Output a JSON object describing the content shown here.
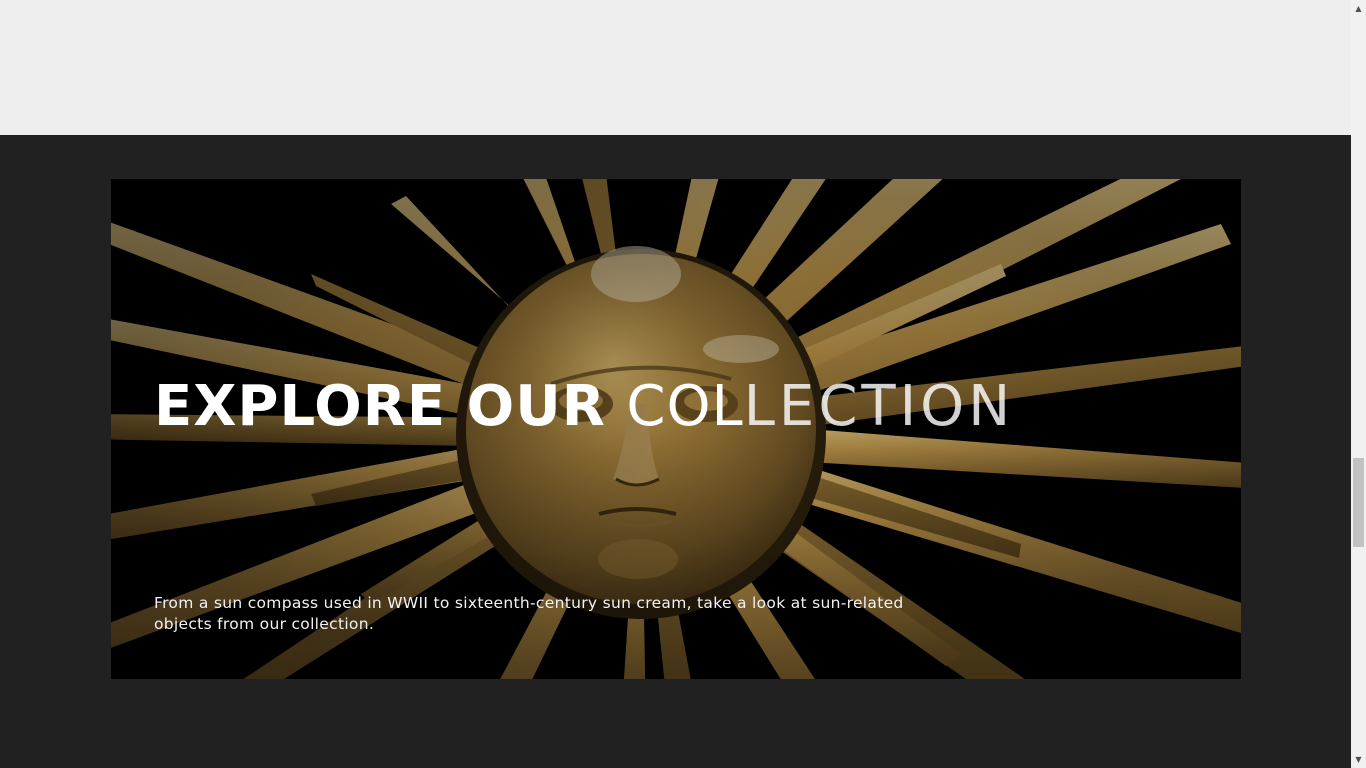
{
  "hero": {
    "title_bold": "EXPLORE OUR ",
    "title_mid": "COL",
    "title_thin": "LECTION",
    "description": "From a sun compass used in WWII to sixteenth-century sun cream, take a look at sun-related objects from our collection.",
    "image_icon": "gilded-sun-face-image"
  },
  "colors": {
    "top_background": "#eeeeee",
    "section_background": "#212121",
    "hero_background": "#000000",
    "gold": "#b08a3e",
    "text": "#ffffff"
  },
  "scrollbar": {
    "up_arrow": "▲",
    "down_arrow": "▼"
  }
}
